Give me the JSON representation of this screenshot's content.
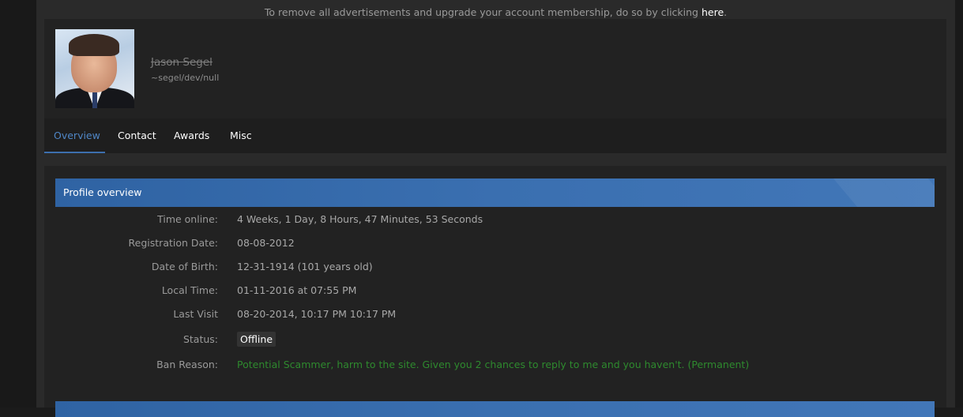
{
  "notice": {
    "text": "To remove all advertisements and upgrade your account membership, do so by clicking ",
    "link": "here",
    "suffix": "."
  },
  "profile": {
    "username": "Jason Segel",
    "usertitle": "~segel/dev/null"
  },
  "tabs": [
    {
      "label": "Overview",
      "active": true
    },
    {
      "label": "Contact",
      "active": false
    },
    {
      "label": "Awards",
      "active": false
    },
    {
      "label": "Misc",
      "active": false
    }
  ],
  "overview": {
    "title": "Profile overview",
    "rows": [
      {
        "label": "Time online:",
        "value": "4 Weeks, 1 Day, 8 Hours, 47 Minutes, 53 Seconds"
      },
      {
        "label": "Registration Date:",
        "value": "08-08-2012"
      },
      {
        "label": "Date of Birth:",
        "value": "12-31-1914 (101 years old)"
      },
      {
        "label": "Local Time:",
        "value": "01-11-2016 at 07:55 PM"
      },
      {
        "label": "Last Visit",
        "value": "08-20-2014, 10:17 PM 10:17 PM"
      },
      {
        "label": "Status:",
        "value": "Offline"
      },
      {
        "label": "Ban Reason:",
        "value": "Potential Scammer, harm to the site. Given you 2 chances to reply to me and you haven't. (Permanent)"
      }
    ]
  },
  "colors": {
    "accent": "#3a6fb0",
    "active_tab": "#4f86c6",
    "ban_text": "#2e8a2e"
  }
}
